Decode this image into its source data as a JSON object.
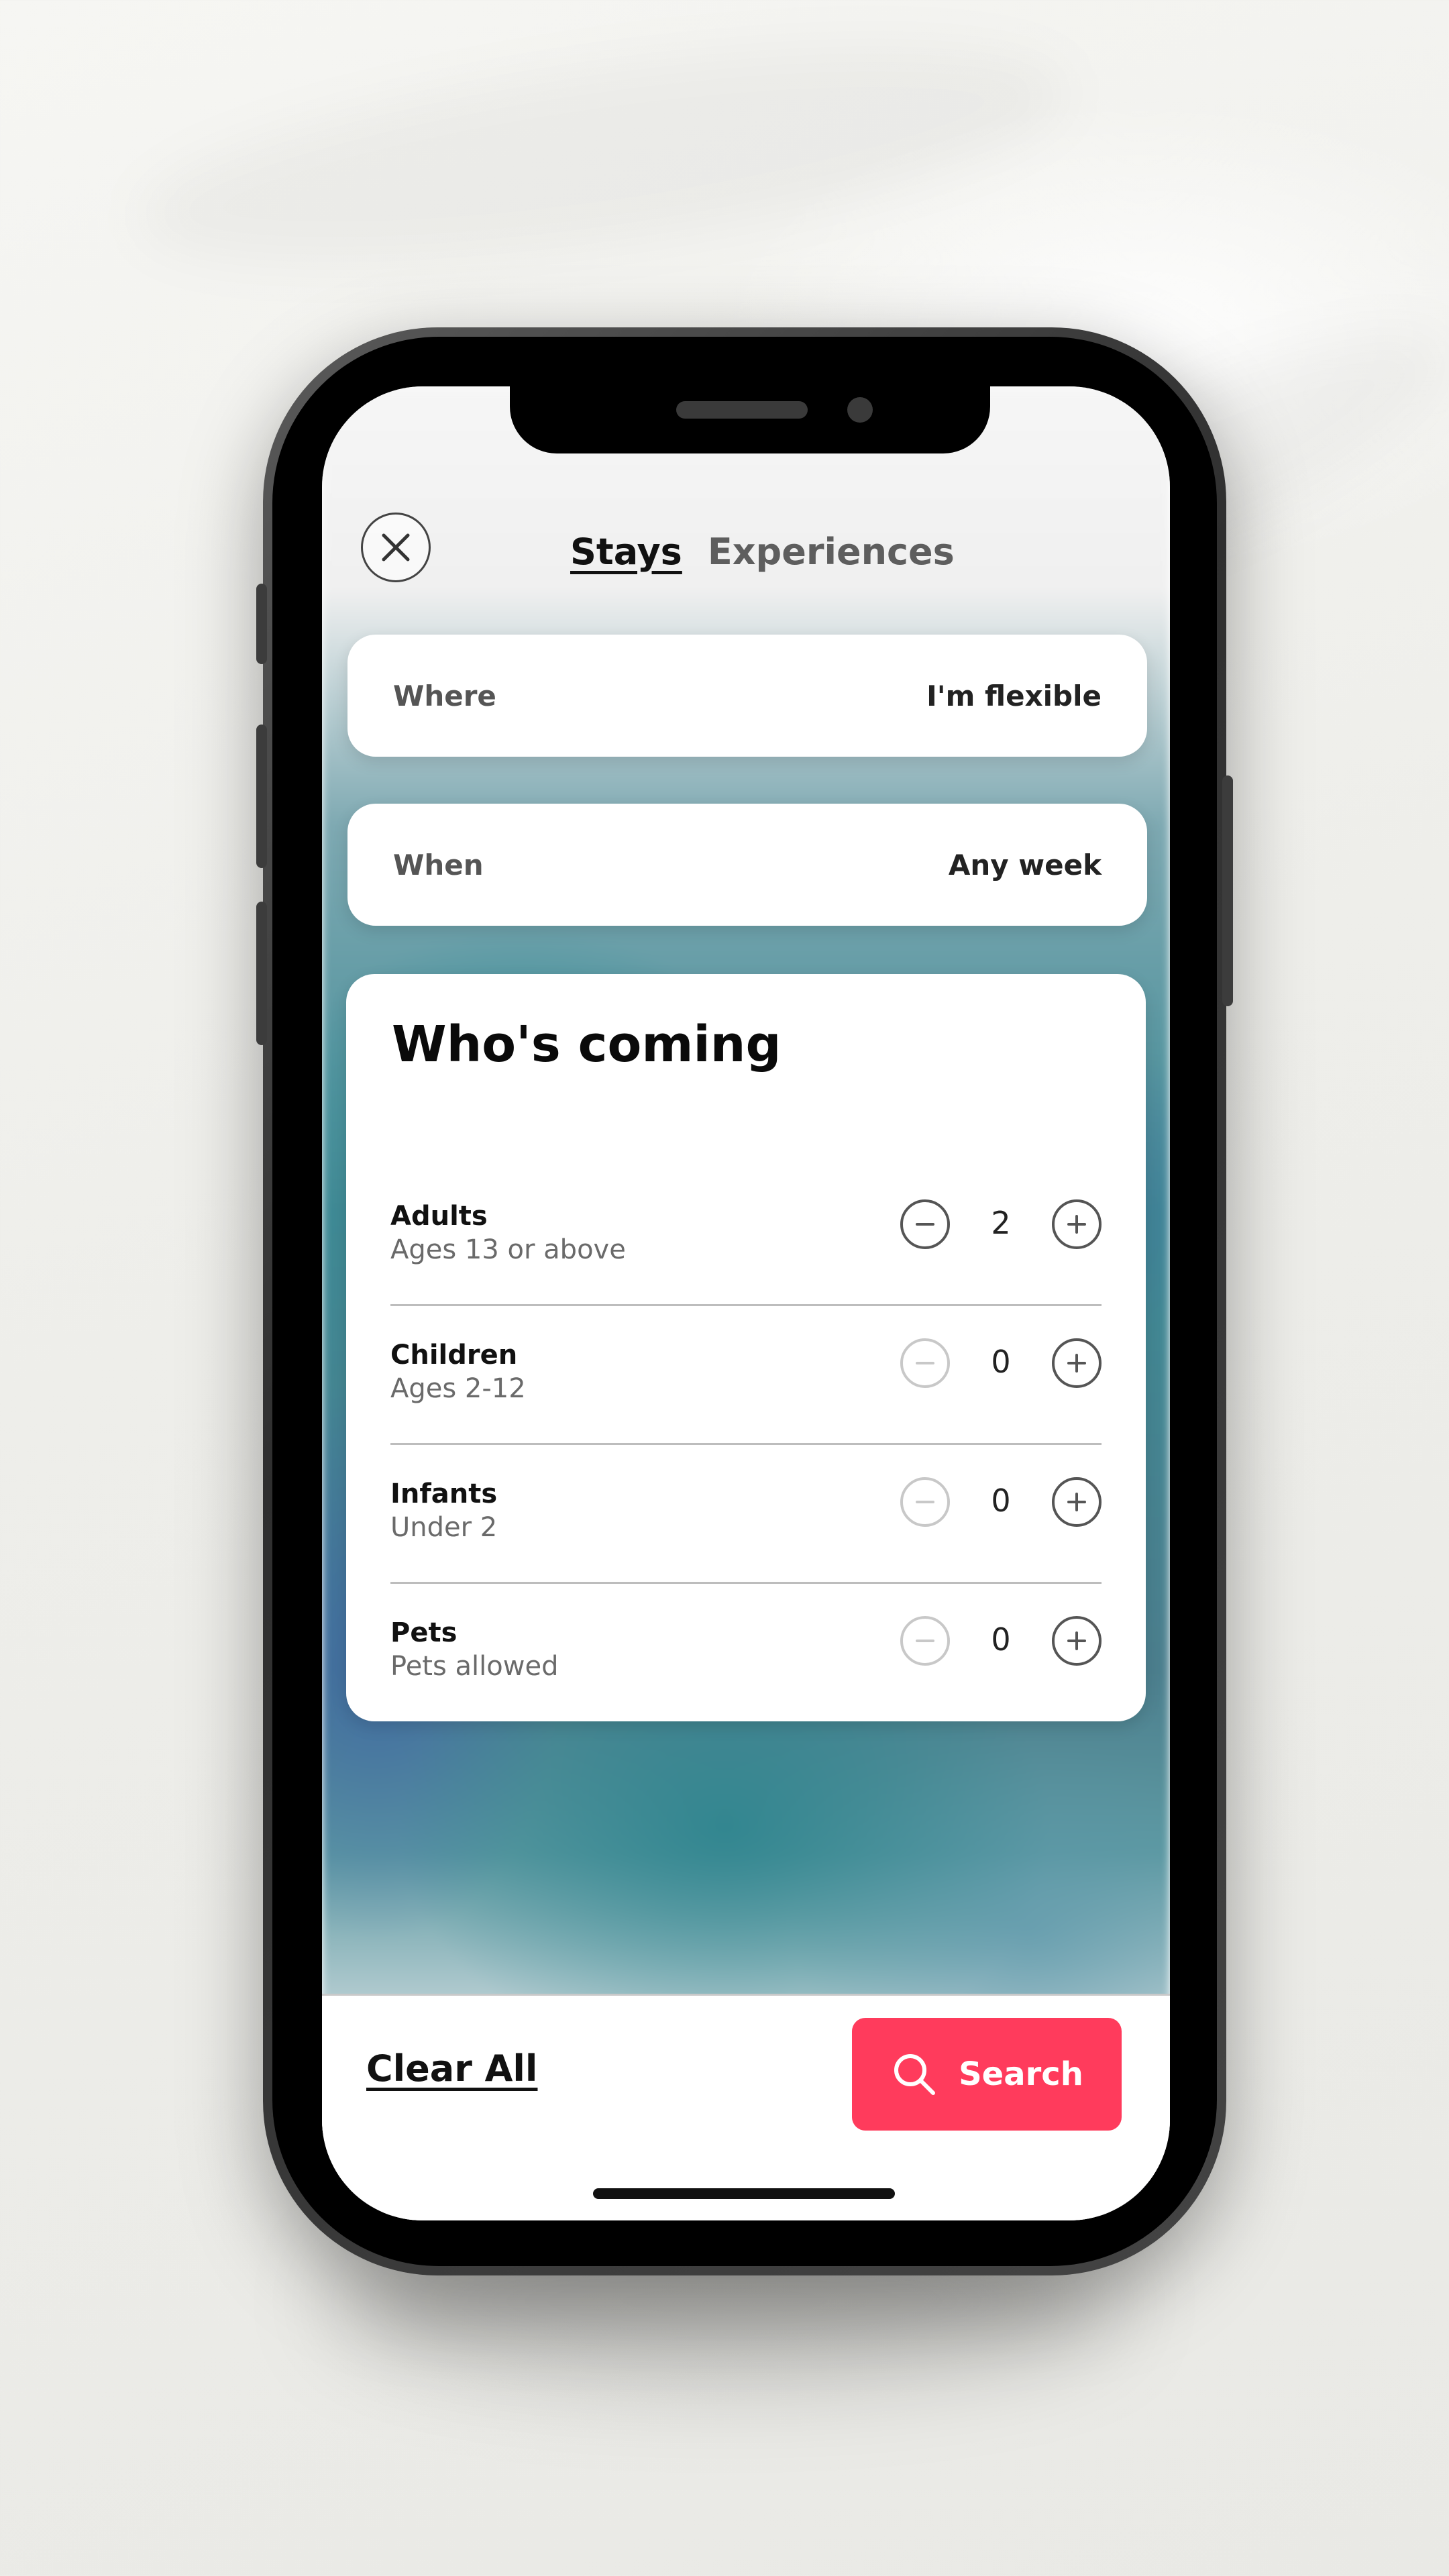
{
  "header": {
    "tabs": [
      {
        "label": "Stays",
        "active": true
      },
      {
        "label": "Experiences",
        "active": false
      }
    ]
  },
  "where": {
    "label": "Where",
    "value": "I'm flexible"
  },
  "when": {
    "label": "When",
    "value": "Any week"
  },
  "guests": {
    "title": "Who's coming",
    "rows": [
      {
        "name": "Adults",
        "desc": "Ages 13 or above",
        "count": "2",
        "minus_enabled": true
      },
      {
        "name": "Children",
        "desc": "Ages 2-12",
        "count": "0",
        "minus_enabled": false
      },
      {
        "name": "Infants",
        "desc": "Under 2",
        "count": "0",
        "minus_enabled": false
      },
      {
        "name": "Pets",
        "desc": "Pets allowed",
        "count": "0",
        "minus_enabled": false
      }
    ]
  },
  "footer": {
    "clear_label": "Clear All",
    "search_label": "Search"
  },
  "colors": {
    "accent": "#ff3b5c",
    "disabled": "#c8c8c8"
  },
  "icons": {
    "close": "close-icon",
    "minus": "minus-icon",
    "plus": "plus-icon",
    "search": "search-icon"
  }
}
